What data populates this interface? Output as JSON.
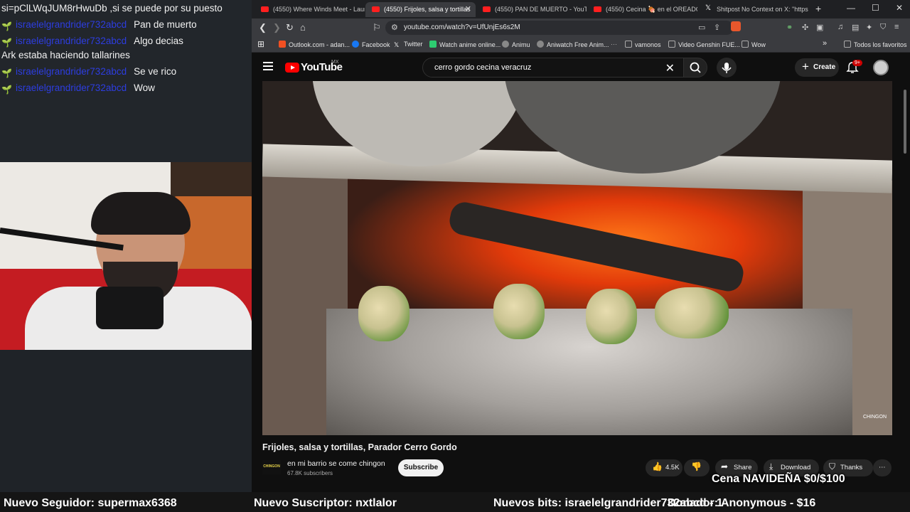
{
  "chat": {
    "lines": [
      {
        "user": "",
        "msg": "si=pClLWqJUM8rHwuDb ,si se puede por su puesto"
      },
      {
        "user": "israelelgrandrider732abcd",
        "msg": "Pan de muerto"
      },
      {
        "user": "israelelgrandrider732abcd",
        "msg": "Algo decias"
      },
      {
        "user": "",
        "msg": "Ark estaba haciendo tallarines"
      },
      {
        "user": "israelelgrandrider732abcd",
        "msg": "Se ve rico"
      },
      {
        "user": "israelelgrandrider732abcd",
        "msg": "Wow"
      }
    ]
  },
  "browser": {
    "tabs": [
      {
        "label": "(4550) Where Winds Meet - Launc"
      },
      {
        "label": "(4550) Frijoles, salsa y tortillas"
      },
      {
        "label": "(4550) PAN DE MUERTO - YouTube"
      },
      {
        "label": "(4550) Cecina 🍖 en el OREADOR"
      },
      {
        "label": "Shitpost No Context on X: \"https:/"
      }
    ],
    "new_tab": "+",
    "url": "youtube.com/watch?v=UfUnjEs6s2M",
    "bookmarks": [
      {
        "label": "Outlook.com - adan...",
        "icon": "outlook-icon",
        "color": "#f25022"
      },
      {
        "label": "Facebook",
        "icon": "facebook-icon",
        "color": "#1877f2"
      },
      {
        "label": "Twitter",
        "icon": "x-icon",
        "color": "#000000"
      },
      {
        "label": "Watch anime online...",
        "icon": "leaf-icon",
        "color": "#2ecc71"
      },
      {
        "label": "Animu",
        "icon": "globe-icon",
        "color": "#888888"
      },
      {
        "label": "Aniwatch Free Anim...",
        "icon": "globe-icon",
        "color": "#888888"
      },
      {
        "label": "vamonos",
        "icon": "folder-icon",
        "color": "#aaaaaa"
      },
      {
        "label": "Video Genshin FUE...",
        "icon": "folder-icon",
        "color": "#aaaaaa"
      },
      {
        "label": "Wow",
        "icon": "folder-icon",
        "color": "#aaaaaa"
      },
      {
        "label": "Todos los favoritos",
        "icon": "folder-icon",
        "color": "#aaaaaa"
      }
    ]
  },
  "youtube": {
    "logo": "YouTube",
    "region": "MX",
    "search_query": "cerro gordo cecina veracruz",
    "create_label": "Create",
    "notifications_badge": "9+",
    "video_title": "Frijoles, salsa y tortillas, Parador Cerro Gordo",
    "channel_name": "en mi barrio se come chingon",
    "channel_avatar_text": "CHINGON",
    "subscribers": "67.8K subscribers",
    "subscribe_label": "Subscribe",
    "likes": "4.5K",
    "share_label": "Share",
    "download_label": "Download",
    "thanks_label": "Thanks",
    "watermark": "CHINGON"
  },
  "overlay": {
    "goal": "Cena NAVIDEÑA $0/$100",
    "ticker": [
      "Nuevo Seguidor: supermax6368",
      "Nuevo Suscriptor: nxtlalor",
      "Nuevos bits: israelelgrandrider732abcd - 1",
      "Donador: Anonymous - $16"
    ]
  },
  "colors": {
    "chat_username": "#2d3de0",
    "yt_red": "#ff0000",
    "bg_dark": "#0f0f0f"
  }
}
